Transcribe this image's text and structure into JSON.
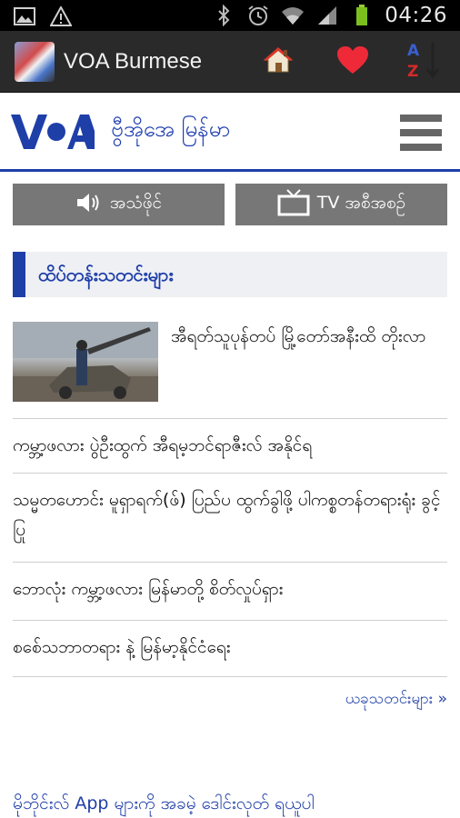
{
  "status_bar": {
    "time": "04:26",
    "left_icons": [
      "gallery-icon",
      "warning-icon"
    ],
    "right_icons": [
      "bluetooth-icon",
      "alarm-icon",
      "wifi-icon",
      "signal-icon",
      "battery-icon"
    ]
  },
  "action_bar": {
    "title": "VOA Burmese",
    "buttons": [
      "home-icon",
      "favorite-heart-icon",
      "sort-az-icon"
    ]
  },
  "header": {
    "logo_text": "VOA",
    "site_name": "ဗွီအိုအေ မြန်မာ"
  },
  "media_buttons": {
    "audio_label": "အသံဖိုင်",
    "tv_label": "TV အစီအစဉ်"
  },
  "section": {
    "title": "ထိပ်တန်းသတင်းများ"
  },
  "news": [
    {
      "title": "အီရတ်သူပုန်တပ် မြို့တော်အနီးထိ တိုးလာ",
      "has_image": true
    },
    {
      "title": "ကမ္ဘာ့ဖလား ပွဲဦးထွက် အီရမ့ဘင်ရာဇီးလ် အနိုင်ရ",
      "has_image": false
    },
    {
      "title": "သမ္မတဟောင်း မူရှာရက်(ဖ်) ပြည်ပ ထွက်ခွါဖို့ ပါကစ္စတန်တရားရုံး ခွင့်ပြု",
      "has_image": false
    },
    {
      "title": "ဘောလုံး ကမ္ဘာ့ဖလား မြန်မာတို့ စိတ်လှုပ်ရှား",
      "has_image": false
    },
    {
      "title": "စစ်ေသဘာတရား နဲ့ မြန်မာ့နိုင်ငံရေး",
      "has_image": false
    }
  ],
  "more_link": "ယခုသတင်းများ »",
  "footer_link": "မိုဘိုင်းလ် App များကို အခမဲ့ ဒေါင်းလုတ် ရယူပါ",
  "colors": {
    "brand_blue": "#1e3ea8",
    "action_bar": "#2a2a2a",
    "button_gray": "#777777"
  }
}
